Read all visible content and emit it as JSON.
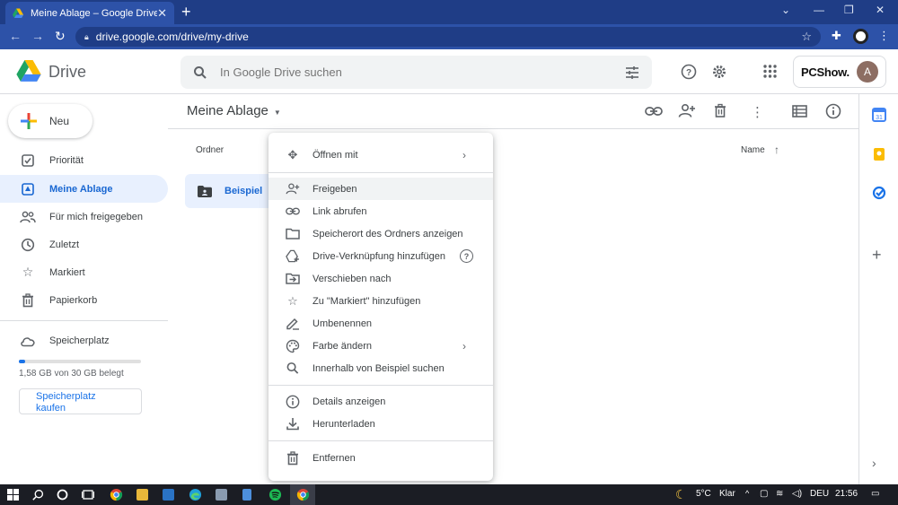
{
  "browser": {
    "tab_title": "Meine Ablage – Google Drive",
    "url": "drive.google.com/drive/my-drive"
  },
  "header": {
    "app_name": "Drive",
    "search_placeholder": "In Google Drive suchen",
    "brand": "PCShow.",
    "avatar_letter": "A"
  },
  "sidebar": {
    "new_label": "Neu",
    "items": [
      {
        "label": "Priorität",
        "icon": "check-square-icon"
      },
      {
        "label": "Meine Ablage",
        "icon": "my-drive-icon"
      },
      {
        "label": "Für mich freigegeben",
        "icon": "shared-people-icon"
      },
      {
        "label": "Zuletzt",
        "icon": "clock-icon"
      },
      {
        "label": "Markiert",
        "icon": "star-icon"
      },
      {
        "label": "Papierkorb",
        "icon": "trash-icon"
      }
    ],
    "storage_label": "Speicherplatz",
    "storage_used_text": "1,58 GB von 30 GB belegt",
    "storage_fraction": 0.053,
    "buy_line1": "Speicherplatz",
    "buy_line2": "kaufen"
  },
  "main": {
    "title": "Meine Ablage",
    "folders_header": "Ordner",
    "sort_label": "Name",
    "folder_name": "Beispiel"
  },
  "context_menu": {
    "items": [
      {
        "label": "Öffnen mit",
        "icon": "open-with-icon",
        "submenu": true
      },
      {
        "label": "Freigeben",
        "icon": "share-person-add-icon"
      },
      {
        "label": "Link abrufen",
        "icon": "link-icon"
      },
      {
        "label": "Speicherort des Ordners anzeigen",
        "icon": "folder-outline-icon"
      },
      {
        "label": "Drive-Verknüpfung hinzufügen",
        "icon": "add-shortcut-icon",
        "help": "?"
      },
      {
        "label": "Verschieben nach",
        "icon": "move-to-icon"
      },
      {
        "label": "Zu \"Markiert\" hinzufügen",
        "icon": "star-outline-icon"
      },
      {
        "label": "Umbenennen",
        "icon": "rename-pencil-icon"
      },
      {
        "label": "Farbe ändern",
        "icon": "palette-icon",
        "submenu": true
      },
      {
        "label": "Innerhalb von Beispiel suchen",
        "icon": "search-icon"
      },
      {
        "label": "Details anzeigen",
        "icon": "info-icon"
      },
      {
        "label": "Herunterladen",
        "icon": "download-icon"
      },
      {
        "label": "Entfernen",
        "icon": "trash-icon"
      }
    ]
  },
  "taskbar": {
    "temperature": "5°C",
    "weather": "Klar",
    "language": "DEU",
    "time": "21:56"
  },
  "colors": {
    "accent": "#1a73e8",
    "active_nav_bg": "#e8f0fe",
    "browser_frame": "#2d52a8"
  }
}
